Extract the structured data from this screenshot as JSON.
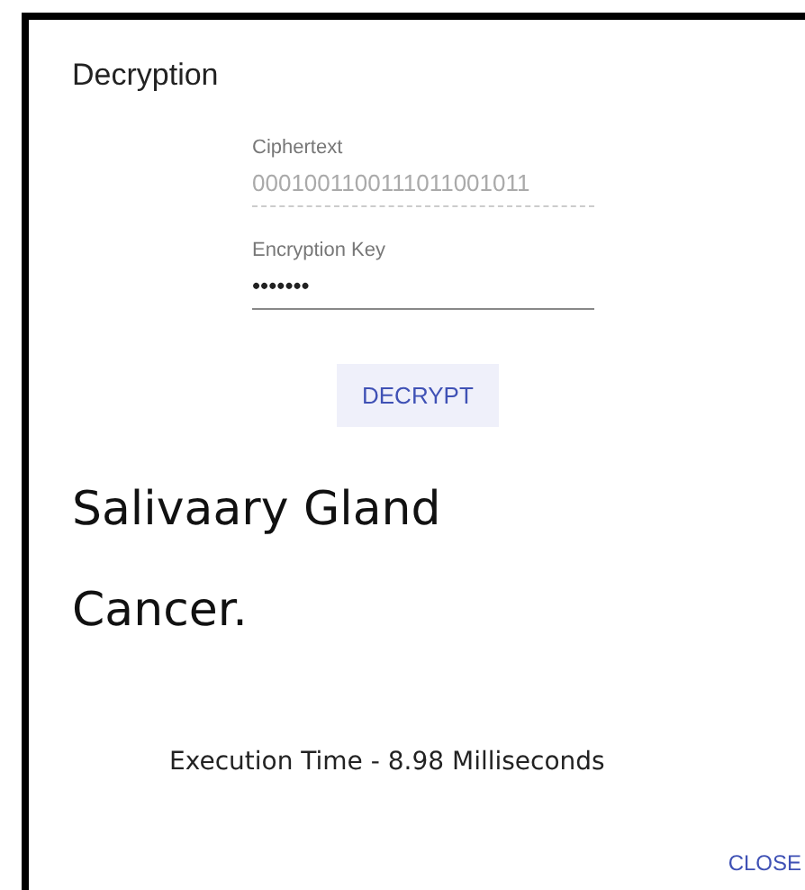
{
  "dialog": {
    "title": "Decryption",
    "fields": [
      {
        "label": "Ciphertext",
        "value": "0001001100111011001011",
        "disabled": true
      },
      {
        "label": "Encryption Key",
        "value": "•••••••",
        "disabled": false
      }
    ],
    "decrypt_button": "DECRYPT",
    "result": "Salivaary Gland Cancer.",
    "execution_time": "Execution Time - 8.98 Milliseconds",
    "close_button": "CLOSE"
  }
}
